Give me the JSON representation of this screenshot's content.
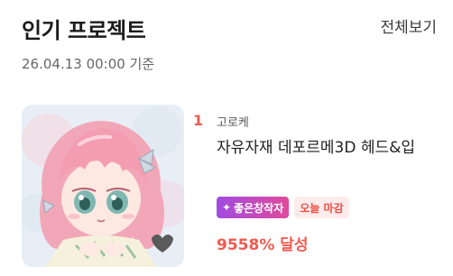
{
  "section": {
    "title": "인기 프로젝트",
    "view_all": "전체보기",
    "timestamp": "26.04.13 00:00 기준"
  },
  "projects": [
    {
      "rank": "1",
      "creator": "고로케",
      "title": "자유자재 데포르메3D 헤드&입",
      "badge_good": "좋은창작자",
      "badge_good_icon": "sparkle-icon",
      "badge_deadline": "오늘 마감",
      "achievement": "9558% 달성"
    }
  ],
  "colors": {
    "accent": "#f05a4f",
    "badge_gradient_start": "#a14be0",
    "badge_gradient_end": "#e14a9b",
    "deadline_bg": "#fdeceb"
  }
}
